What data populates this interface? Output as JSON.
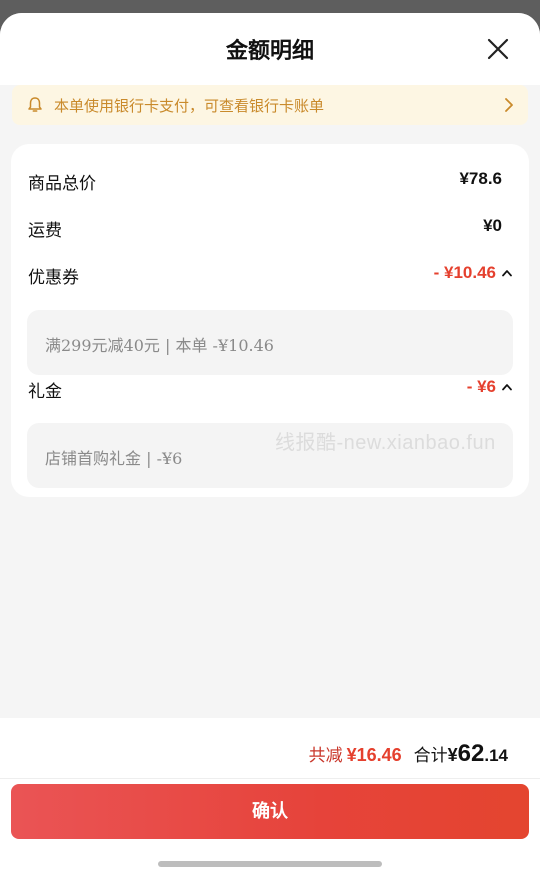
{
  "header": {
    "title": "金额明细",
    "close_icon": "close-icon"
  },
  "notice": {
    "text": "本单使用银行卡支付，可查看银行卡账单",
    "icon": "bell-icon",
    "color": "#c98a2b"
  },
  "rows": {
    "goods_total": {
      "label": "商品总价",
      "value": "¥78.6"
    },
    "shipping": {
      "label": "运费",
      "value": "¥0"
    },
    "coupon": {
      "label": "优惠券",
      "value": "- ¥10.46",
      "detail": "满299元减40元 | 本单 -¥10.46"
    },
    "gift": {
      "label": "礼金",
      "value": "- ¥6",
      "detail": "店铺首购礼金 | -¥6"
    }
  },
  "watermark": "线报酷-new.xianbao.fun",
  "footer": {
    "saved_label": "共减",
    "saved_amount": "¥16.46",
    "total_label": "合计",
    "total_currency": "¥",
    "total_integer": "62",
    "total_decimal": ".14",
    "confirm_label": "确认"
  },
  "colors": {
    "accent_red": "#e5402e",
    "button_gradient_start": "#ea5455",
    "button_gradient_end": "#e4452f"
  }
}
